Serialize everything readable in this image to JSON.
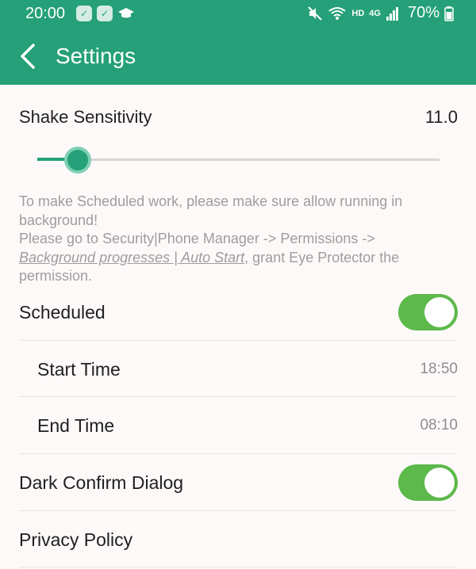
{
  "status_bar": {
    "time": "20:00",
    "indicators": [
      "HD",
      "4G"
    ],
    "battery": "70%",
    "icons": [
      "notification-check-icon",
      "notification-check-icon",
      "graduation-cap-icon",
      "mute-icon",
      "wifi-icon",
      "signal-icon",
      "battery-icon"
    ]
  },
  "app_bar": {
    "title": "Settings",
    "back_icon": "chevron-left-icon"
  },
  "shake": {
    "label": "Shake Sensitivity",
    "value": "11.0",
    "slider_fraction": 0.1
  },
  "notice": {
    "line1": "To make Scheduled work, please make sure allow running in background!",
    "line2": "Please go to Security|Phone Manager -> Permissions ->",
    "link": "Background progresses | Auto Start",
    "line3": ", grant Eye Protector the permission."
  },
  "settings": {
    "scheduled": {
      "label": "Scheduled",
      "enabled": true
    },
    "start_time": {
      "label": "Start Time",
      "value": "18:50"
    },
    "end_time": {
      "label": "End Time",
      "value": "08:10"
    },
    "dark_confirm": {
      "label": "Dark Confirm Dialog",
      "enabled": true
    },
    "privacy": {
      "label": "Privacy Policy"
    }
  },
  "colors": {
    "accent": "#25a079",
    "toggle_on": "#5cb94a",
    "background": "#fdf9f8",
    "muted_text": "#9d9d9d"
  }
}
